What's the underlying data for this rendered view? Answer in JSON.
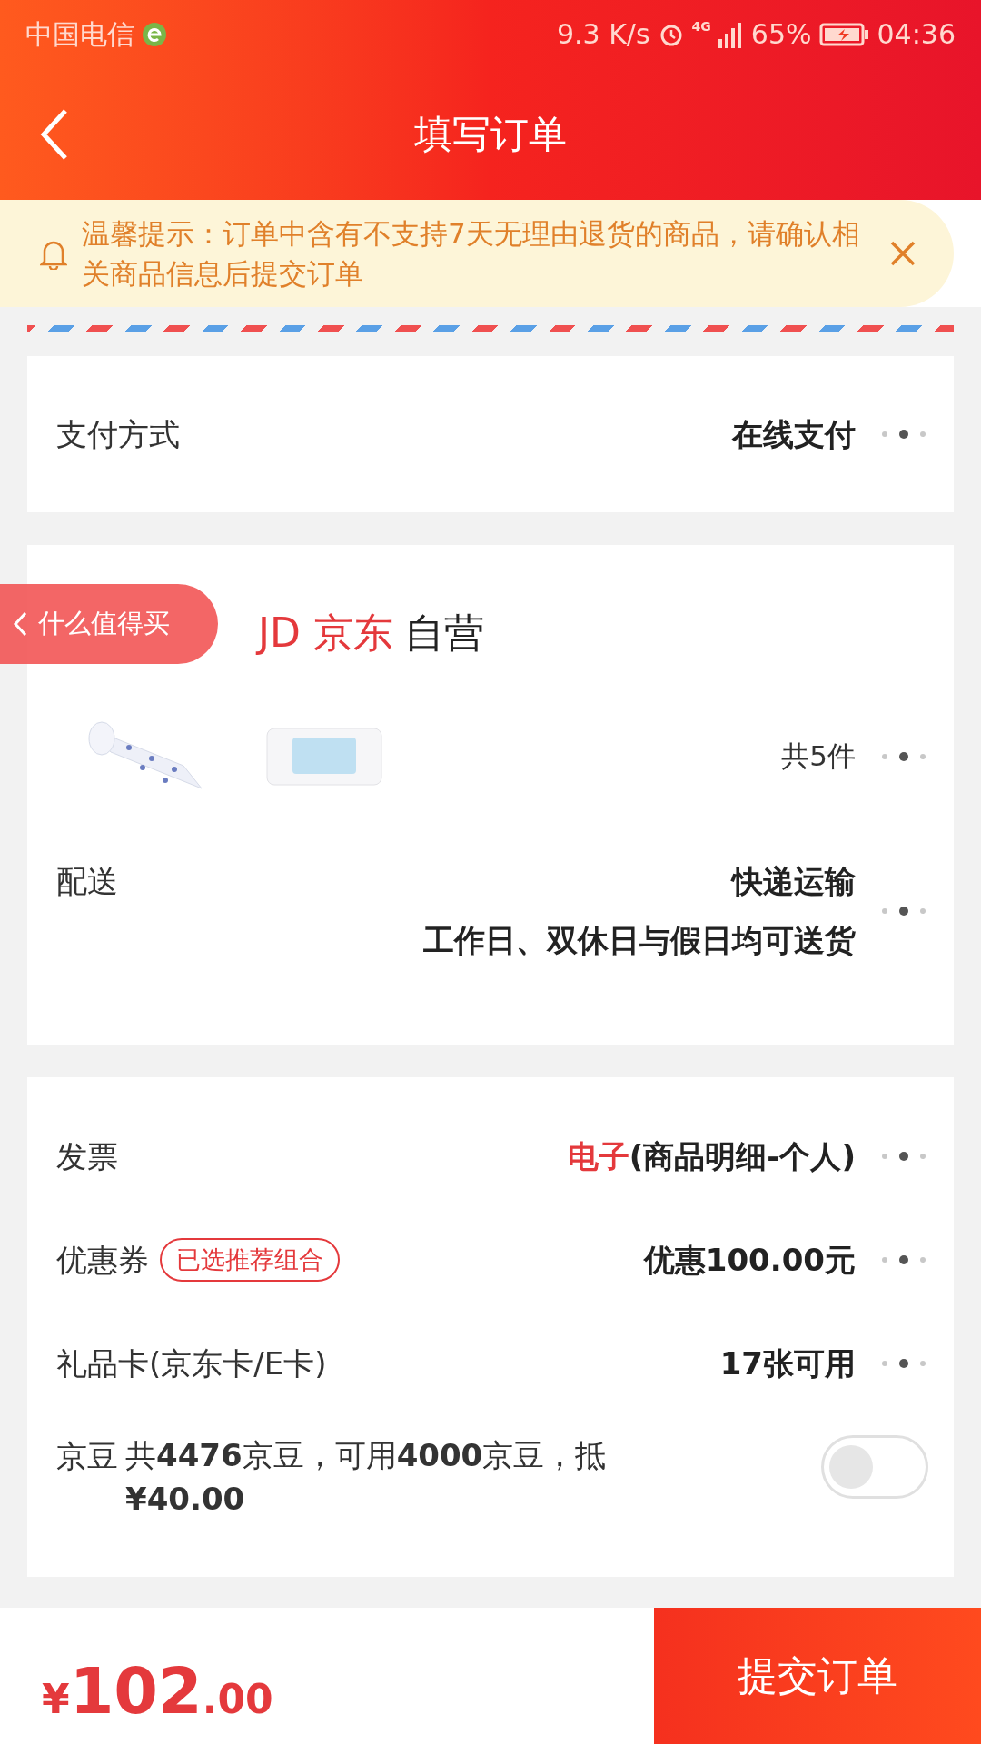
{
  "status_bar": {
    "carrier": "中国电信",
    "speed": "9.3 K/s",
    "network": "4G",
    "battery": "65%",
    "time": "04:36"
  },
  "header": {
    "title": "填写订单"
  },
  "notice": {
    "text": "温馨提示：订单中含有不支持7天无理由退货的商品，请确认相关商品信息后提交订单"
  },
  "payment": {
    "label": "支付方式",
    "value": "在线支付"
  },
  "store": {
    "logo_text": "JD 京东",
    "name": "自营",
    "floating_button": "什么值得买",
    "item_count": "共5件",
    "delivery": {
      "label": "配送",
      "method": "快递运输",
      "schedule": "工作日、双休日与假日均可送货"
    }
  },
  "options": [
    {
      "kind": "invoice",
      "label": "发票",
      "highlight": "电子",
      "value": "(商品明细-个人)"
    },
    {
      "kind": "coupon",
      "label": "优惠券",
      "tag": "已选推荐组合",
      "value": "优惠100.00元"
    },
    {
      "kind": "giftcard",
      "label": "礼品卡(京东卡/E卡)",
      "value": "17张可用"
    },
    {
      "kind": "beans",
      "label": "京豆",
      "value": "共**4476**京豆，可用**4000**京豆，抵 **¥40.00**",
      "on": false
    }
  ],
  "footer": {
    "currency": "¥",
    "amount": "102",
    "decimals": ".00",
    "submit": "提交订单"
  }
}
